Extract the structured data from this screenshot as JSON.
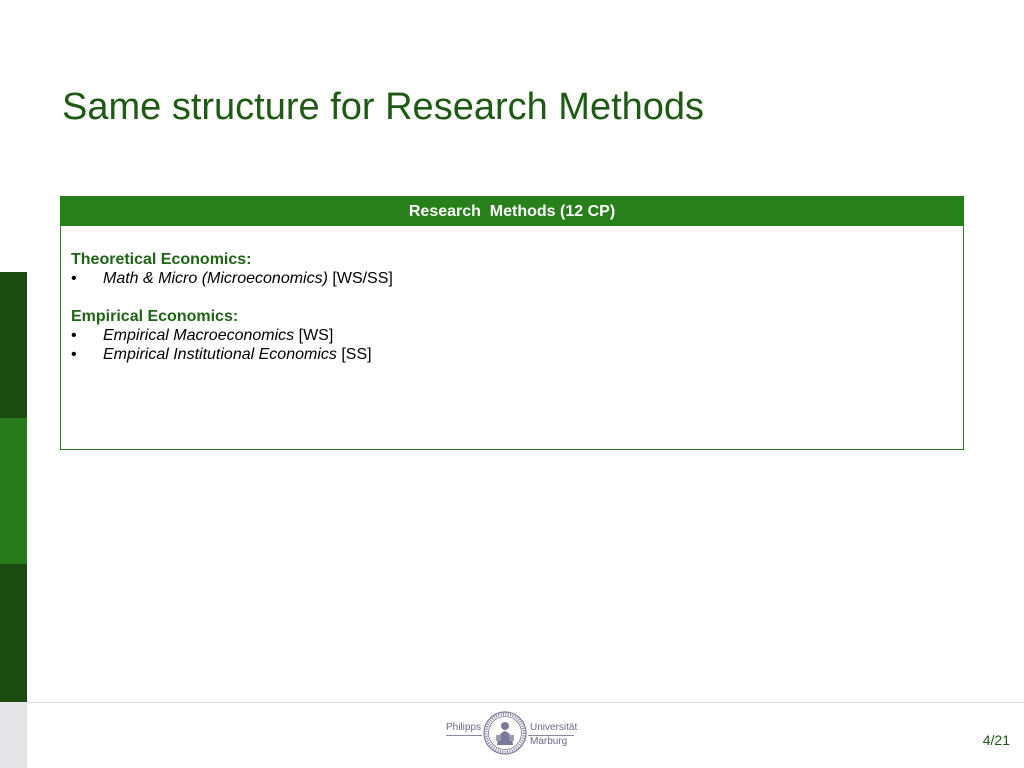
{
  "slide": {
    "title": "Same structure for Research Methods",
    "page_number": "4/21"
  },
  "table": {
    "header": "Research  Methods (12 CP)",
    "sections": [
      {
        "heading": "Theoretical Economics:",
        "items": [
          {
            "course": "Math & Micro (Microeconomics)",
            "term": "[WS/SS]"
          }
        ]
      },
      {
        "heading": "Empirical Economics:",
        "items": [
          {
            "course": "Empirical Macroeconomics",
            "term": "[WS]"
          },
          {
            "course": "Empirical Institutional Economics",
            "term": "[SS]"
          }
        ]
      }
    ],
    "bullet": "•"
  },
  "logo": {
    "left_text": "Philipps",
    "right_text_1": "Universität",
    "right_text_2": "Marburg",
    "seal_icon": "university-seal-icon"
  },
  "colors": {
    "title": "#1e5a14",
    "accent_green": "#27801a",
    "dark_green": "#1b4b10"
  }
}
